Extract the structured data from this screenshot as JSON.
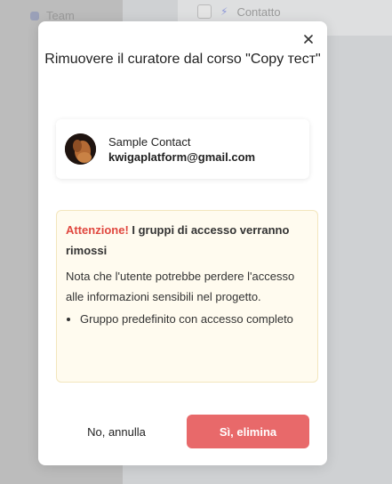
{
  "background": {
    "sidebar_item_label": "Team",
    "topbar_item_label": "Contatto"
  },
  "modal": {
    "title": "Rimuovere il curatore dal corso \"Copy тест\"",
    "close_icon": "close-icon",
    "contact": {
      "name": "Sample Contact",
      "email": "kwigaplatform@gmail.com"
    },
    "warning": {
      "attention_label": "Attenzione!",
      "headline": " I gruppi di accesso verranno rimossi",
      "body": "Nota che l'utente potrebbe perdere l'accesso alle informazioni sensibili nel progetto.",
      "groups": [
        "Gruppo predefinito con accesso completo"
      ]
    },
    "cancel_label": "No, annulla",
    "confirm_label": "Sì, elimina"
  },
  "colors": {
    "accent": "#e8696a",
    "attention": "#e0473f",
    "warning_bg": "#fffbef"
  }
}
